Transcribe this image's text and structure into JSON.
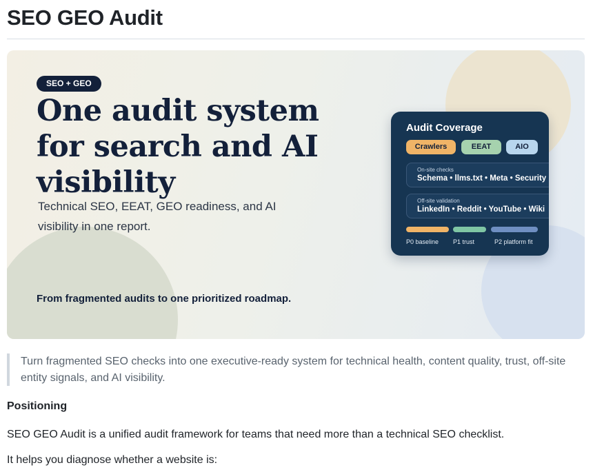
{
  "page": {
    "title": "SEO GEO Audit"
  },
  "hero": {
    "badge": "SEO + GEO",
    "title": "One audit system for search and AI visibility",
    "subtitle": "Technical SEO, EEAT, GEO readiness, and AI visibility in one report.",
    "tagline": "From fragmented audits to one prioritized roadmap.",
    "colors": {
      "navy": "#13203a",
      "card": "#163552",
      "orange": "#f0b467",
      "green": "#a6d2ae",
      "light_blue": "#b8d6ee"
    }
  },
  "coverage_card": {
    "title": "Audit Coverage",
    "chips": [
      "Crawlers",
      "EEAT",
      "AIO"
    ],
    "onsite": {
      "label": "On-site checks",
      "items": "Schema • llms.txt • Meta • Security"
    },
    "offsite": {
      "label": "Off-site validation",
      "items": "LinkedIn • Reddit • YouTube • Wiki"
    },
    "phases": [
      "P0 baseline",
      "P1 trust",
      "P2 platform fit"
    ]
  },
  "content": {
    "quote": "Turn fragmented SEO checks into one executive-ready system for technical health, content quality, trust, off-site entity signals, and AI visibility.",
    "positioning_heading": "Positioning",
    "paragraph_1": "SEO GEO Audit is a unified audit framework for teams that need more than a technical SEO checklist.",
    "paragraph_2": "It helps you diagnose whether a website is:"
  }
}
